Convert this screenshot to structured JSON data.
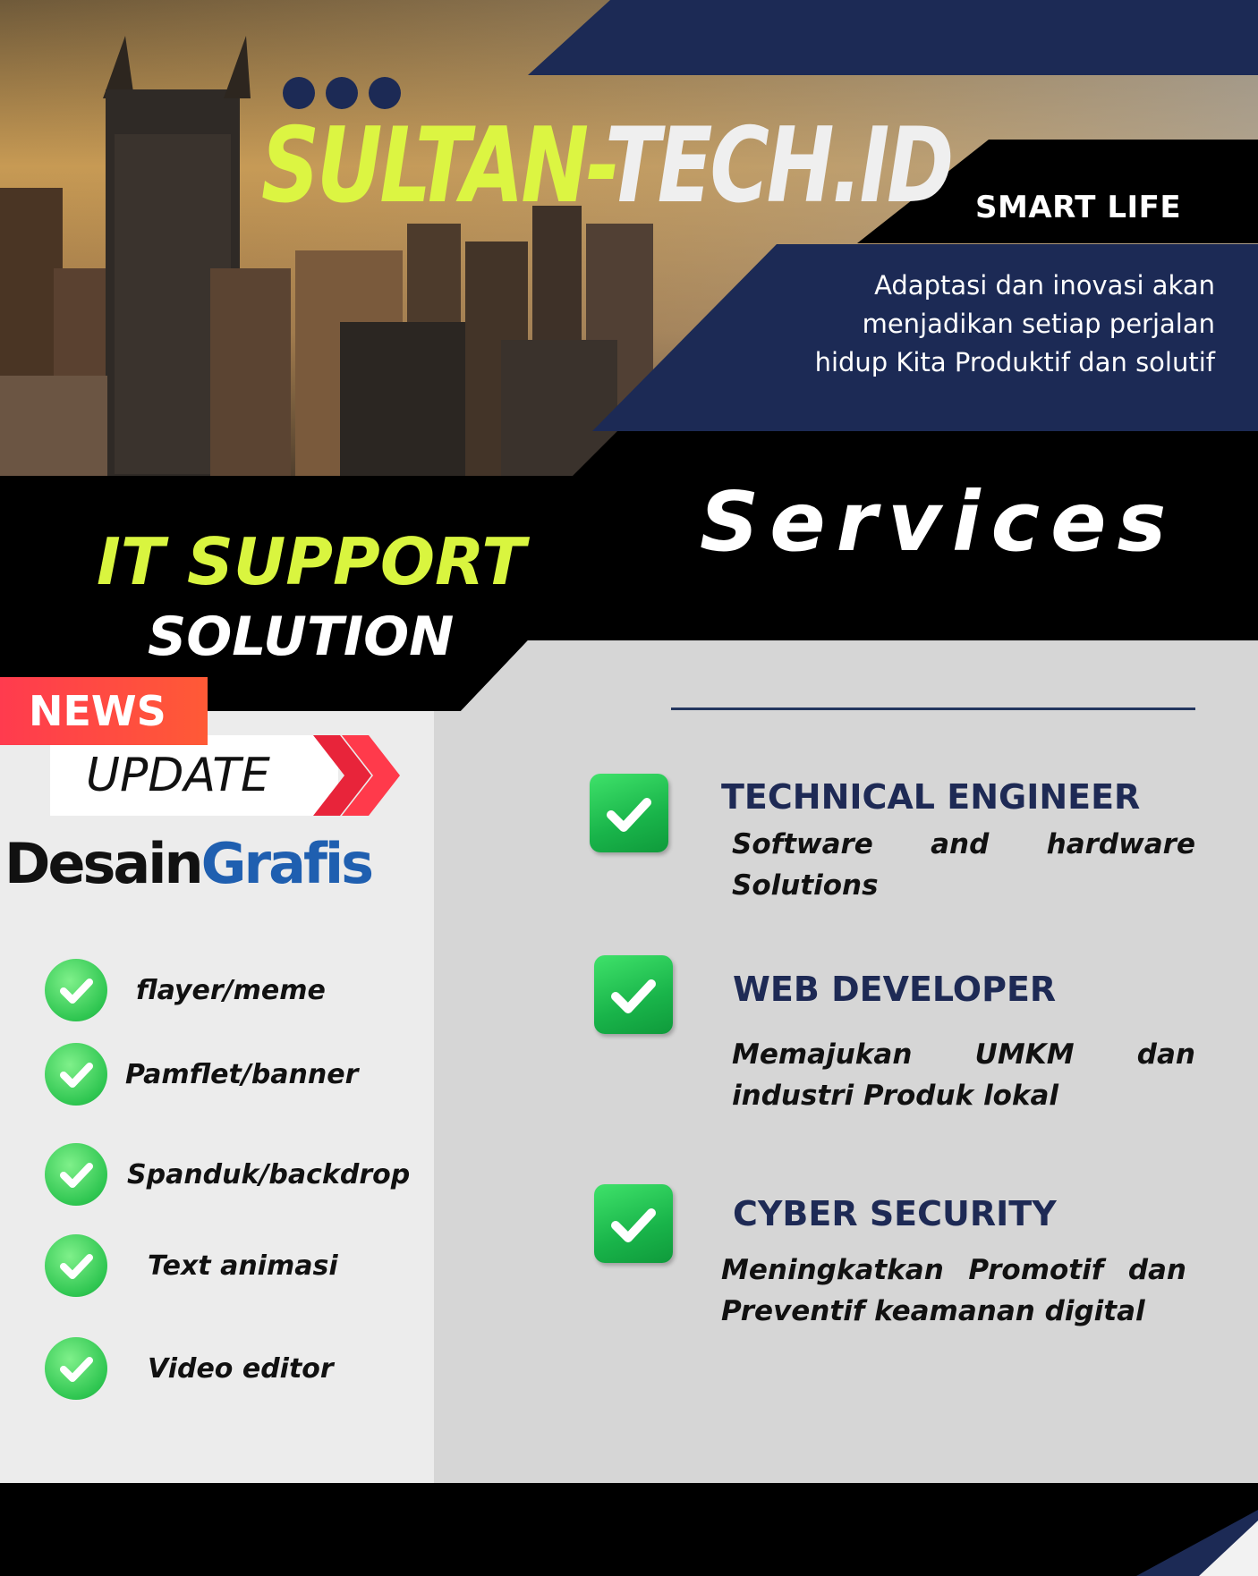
{
  "header": {
    "brand_part1": "SULTAN-",
    "brand_part2": "TECH.ID",
    "smart_life": "SMART LIFE",
    "tagline_lines": [
      "Adaptasi dan inovasi akan",
      "menjadikan setiap perjalan",
      "hidup Kita Produktif dan solutif"
    ]
  },
  "banner": {
    "services": "Services",
    "it_support": "IT SUPPORT",
    "solution": "SOLUTION"
  },
  "news": {
    "badge": "NEWS",
    "update": "UPDATE"
  },
  "graphic_design": {
    "title_part1": "Desain",
    "title_part2": "Grafis",
    "items": [
      "flayer/meme",
      "Pamflet/banner",
      "Spanduk/backdrop",
      "Text animasi",
      "Video editor"
    ]
  },
  "services": [
    {
      "title": "TECHNICAL ENGINEER",
      "description": "Software and hardware Solutions"
    },
    {
      "title": "WEB DEVELOPER",
      "description": "Memajukan UMKM dan industri Produk lokal"
    },
    {
      "title": "CYBER SECURITY",
      "description": "Meningkatkan Promotif dan Preventif keamanan digital"
    }
  ],
  "colors": {
    "navy": "#1c2a55",
    "lime": "#dcf542",
    "news_red": "#ff3b4e",
    "check_green": "#2fc651",
    "left_panel": "#ececec",
    "right_panel": "#d6d6d6"
  }
}
